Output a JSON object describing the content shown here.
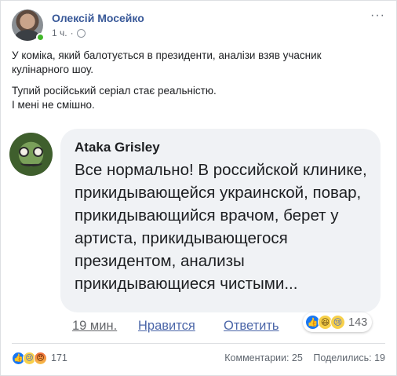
{
  "post": {
    "author": "Олексій Мосейко",
    "time": "1 ч.",
    "privacy_icon": "globe-icon",
    "more": "···",
    "paragraphs": [
      "У коміка, який балотується в президенти, аналізи взяв учасник кулінарного шоу.",
      "Тупий російський серіал стає реальністю.\nІ мені не смішно."
    ]
  },
  "comment": {
    "author": "Ataka Grisley",
    "text": "Все нормально! В российской клинике, прикидывающейся украинской, повар, прикидывающийся врачом, берет у артиста, прикидывающегося президентом, анализы прикидывающиеся чистыми...",
    "time": "19 мин.",
    "like": "Нравится",
    "reply": "Ответить",
    "reactions": [
      "like",
      "haha",
      "sad"
    ],
    "reaction_count": "143"
  },
  "footer": {
    "reactions": [
      "like",
      "sad",
      "angry"
    ],
    "reaction_count": "171",
    "comments": "Комментарии: 25",
    "shares": "Поделились: 19"
  },
  "colors": {
    "link": "#385898",
    "online": "#42b72a",
    "like_blue": "#1877f2"
  }
}
